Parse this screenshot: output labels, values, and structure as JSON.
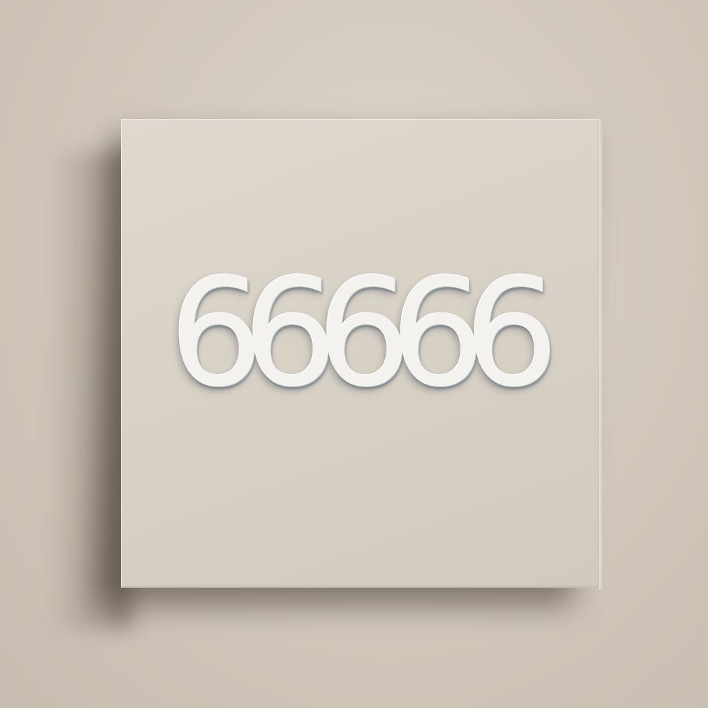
{
  "scene": {
    "panel_text": "66666"
  },
  "colors": {
    "wall": "#d3cabd",
    "panel": "#d9d2c7",
    "numerals": "#f3f2ef"
  }
}
